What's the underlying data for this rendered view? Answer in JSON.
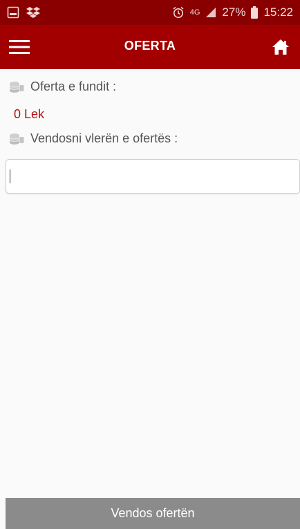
{
  "status_bar": {
    "icons_left": [
      "image-icon",
      "dropbox-icon"
    ],
    "network": "4G",
    "battery_percent": "27%",
    "time": "15:22"
  },
  "app_bar": {
    "title": "OFERTA",
    "menu_icon": "hamburger-menu-icon",
    "home_icon": "home-icon"
  },
  "offer": {
    "last_offer_label": "Oferta e fundit :",
    "last_offer_value": "0 Lek",
    "enter_offer_label": "Vendosni vlerën e ofertës :",
    "input_value": "",
    "input_placeholder": ""
  },
  "actions": {
    "submit_label": "Vendos ofertën"
  },
  "colors": {
    "status_bar_bg": "#8a0000",
    "app_bar_bg": "#a20000",
    "value_text": "#b01212",
    "button_bg": "#8b8b8b"
  }
}
